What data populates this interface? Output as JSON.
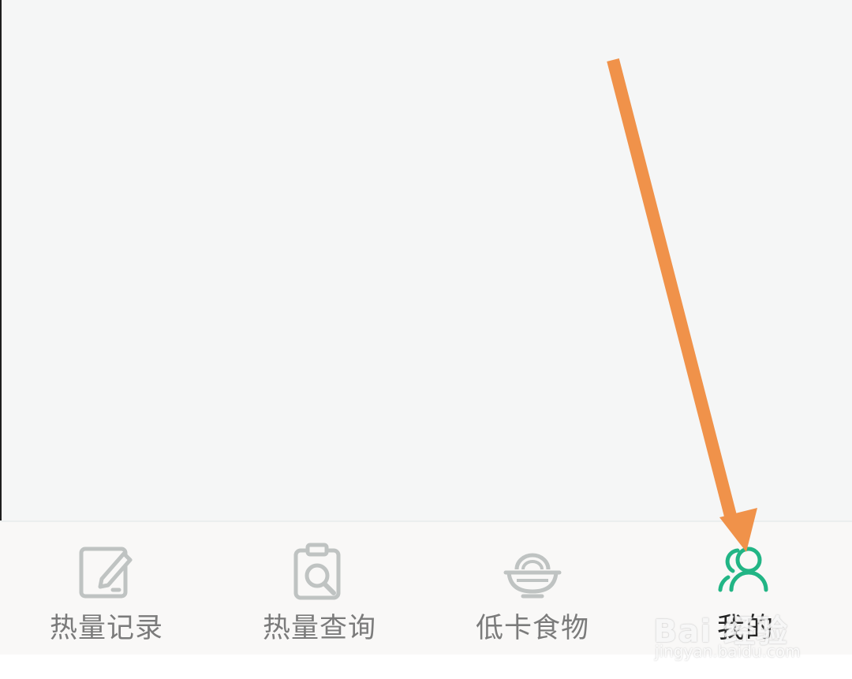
{
  "tabs": [
    {
      "label": "热量记录",
      "icon": "edit-note-icon",
      "active": false
    },
    {
      "label": "热量查询",
      "icon": "clipboard-search-icon",
      "active": false
    },
    {
      "label": "低卡食物",
      "icon": "food-bowl-icon",
      "active": false
    },
    {
      "label": "我的",
      "icon": "users-icon",
      "active": true
    }
  ],
  "colors": {
    "background": "#f5f6f6",
    "tab_bar": "#f9f8f7",
    "icon_inactive": "#bfc3c2",
    "icon_active": "#22b585",
    "label_inactive": "#7b7b7b",
    "label_active": "#222222",
    "annotation_arrow": "#f0924a"
  },
  "watermark": {
    "brand": "Bai 经验",
    "url": "jingyan.baidu.com"
  }
}
